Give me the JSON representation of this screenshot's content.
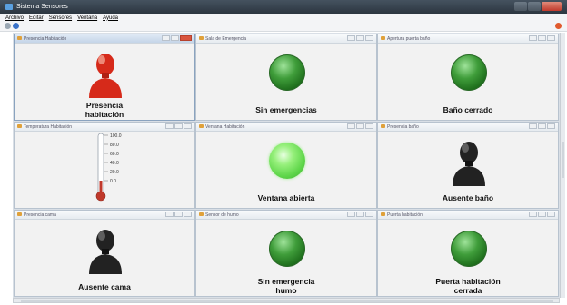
{
  "window": {
    "title": "Sistema Sensores"
  },
  "menu": [
    "Archivo",
    "Editar",
    "Sensores",
    "Ventana",
    "Ayuda"
  ],
  "panels": [
    {
      "title": "Presencia Habitación",
      "caption": "Presencia\nhabitación",
      "indicator": "person-icon",
      "color": "#d62a1a"
    },
    {
      "title": "Sala de Emergencia",
      "caption": "Sin emergencias",
      "indicator": "led",
      "color": "#2e8b2a"
    },
    {
      "title": "Apertura puerta baño",
      "caption": "Baño cerrado",
      "indicator": "led",
      "color": "#2e8b2a"
    },
    {
      "title": "Temperatura Habitación",
      "caption": "",
      "indicator": "thermometer-icon",
      "color": "#c0392b"
    },
    {
      "title": "Ventana Habitación",
      "caption": "Ventana abierta",
      "indicator": "led-on",
      "color": "#5fd64a"
    },
    {
      "title": "Presencia baño",
      "caption": "Ausente baño",
      "indicator": "person-icon",
      "color": "#222222"
    },
    {
      "title": "Presencia cama",
      "caption": "Ausente cama",
      "indicator": "person-icon",
      "color": "#222222"
    },
    {
      "title": "Sensor de humo",
      "caption": "Sin emergencia\nhumo",
      "indicator": "led",
      "color": "#2e8b2a"
    },
    {
      "title": "Puerta habitación",
      "caption": "Puerta habitación\ncerrada",
      "indicator": "led",
      "color": "#2e8b2a"
    }
  ],
  "thermometer": {
    "ticks": [
      "100.0",
      "80.0",
      "60.0",
      "40.0",
      "20.0",
      "0.0"
    ]
  }
}
